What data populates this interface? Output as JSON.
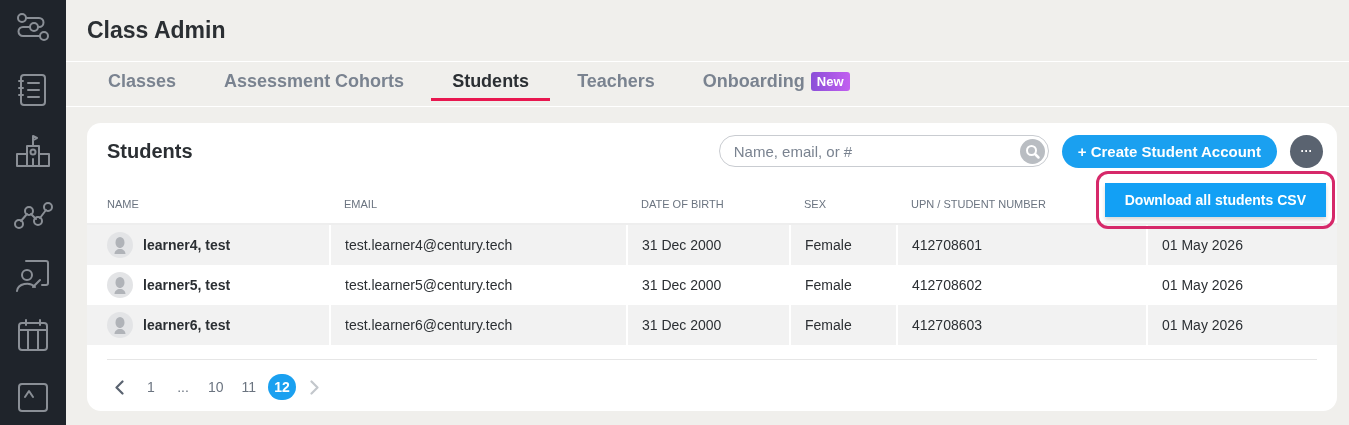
{
  "page_title": "Class Admin",
  "tabs": [
    {
      "label": "Classes",
      "selected": false
    },
    {
      "label": "Assessment Cohorts",
      "selected": false
    },
    {
      "label": "Students",
      "selected": true
    },
    {
      "label": "Teachers",
      "selected": false
    },
    {
      "label": "Onboarding",
      "selected": false,
      "badge": "New"
    }
  ],
  "card": {
    "title": "Students",
    "search": {
      "placeholder": "Name, email, or #"
    },
    "create_button": "+ Create Student Account",
    "more_button": "···",
    "menu": {
      "items": [
        "Download all students CSV"
      ]
    },
    "table": {
      "columns": [
        "NAME",
        "EMAIL",
        "DATE OF BIRTH",
        "SEX",
        "UPN / STUDENT NUMBER"
      ],
      "rows": [
        [
          "learner4, test",
          "test.learner4@century.tech",
          "31 Dec 2000",
          "Female",
          "412708601",
          "01 May 2026"
        ],
        [
          "learner5, test",
          "test.learner5@century.tech",
          "31 Dec 2000",
          "Female",
          "412708602",
          "01 May 2026"
        ],
        [
          "learner6, test",
          "test.learner6@century.tech",
          "31 Dec 2000",
          "Female",
          "412708603",
          "01 May 2026"
        ]
      ]
    },
    "pagination": {
      "prev_disabled": false,
      "next_disabled": true,
      "pages": [
        {
          "label": "1",
          "selected": false
        },
        {
          "label": "...",
          "selected": false
        },
        {
          "label": "10",
          "selected": false
        },
        {
          "label": "11",
          "selected": false
        },
        {
          "label": "12",
          "selected": true
        }
      ]
    }
  }
}
